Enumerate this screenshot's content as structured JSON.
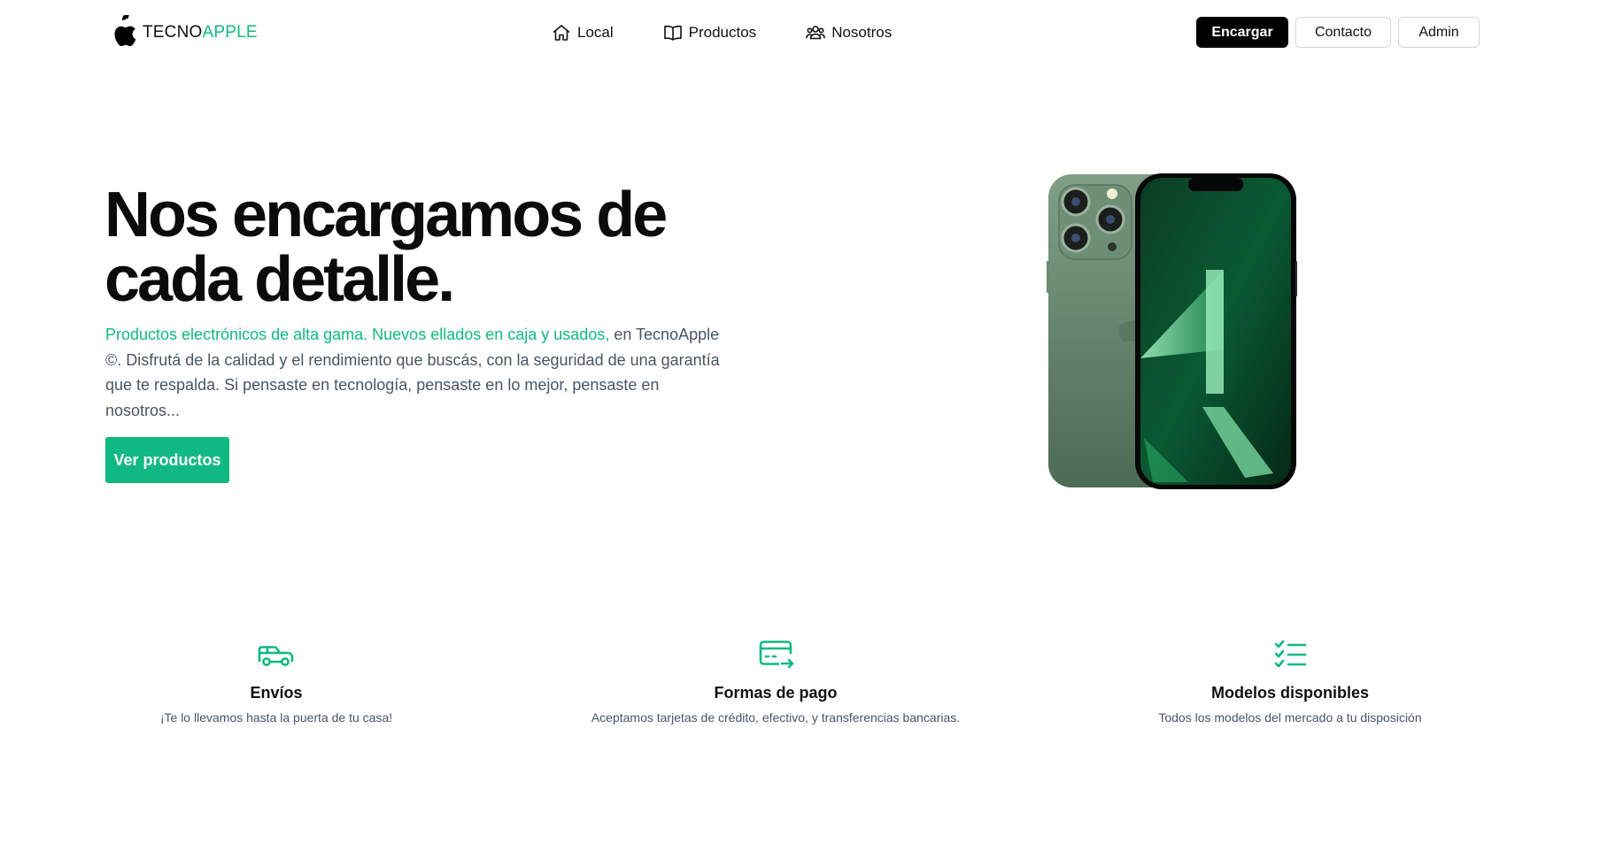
{
  "header": {
    "brand_part1": "TECNO",
    "brand_part2": "APPLE",
    "nav": [
      {
        "label": "Local",
        "icon": "home-icon"
      },
      {
        "label": "Productos",
        "icon": "book-icon"
      },
      {
        "label": "Nosotros",
        "icon": "users-icon"
      }
    ],
    "actions": {
      "order_label": "Encargar",
      "contact_label": "Contacto",
      "admin_label": "Admin"
    }
  },
  "hero": {
    "title_line1": "Nos encargamos de",
    "title_line2": "cada detalle.",
    "highlight": "Productos electrónicos de alta gama. Nuevos ellados en caja y usados,",
    "body": " en TecnoApple ©. Disfrutá de la calidad y el rendimiento que buscás, con la seguridad de una garantía que te respalda. Si pensaste en tecnología, pensaste en lo mejor, pensaste en nosotros...",
    "cta_label": "Ver productos"
  },
  "features": [
    {
      "icon": "truck-icon",
      "title": "Envíos",
      "desc": "¡Te lo llevamos hasta la puerta de tu casa!"
    },
    {
      "icon": "credit-card-icon",
      "title": "Formas de pago",
      "desc": "Aceptamos tarjetas de crédito, efectivo, y transferencias bancarias."
    },
    {
      "icon": "checklist-icon",
      "title": "Modelos disponibles",
      "desc": "Todos los modelos del mercado a tu disposición"
    }
  ],
  "colors": {
    "accent": "#10b981",
    "dark_button": "#000000",
    "body_text": "#4b5563"
  }
}
